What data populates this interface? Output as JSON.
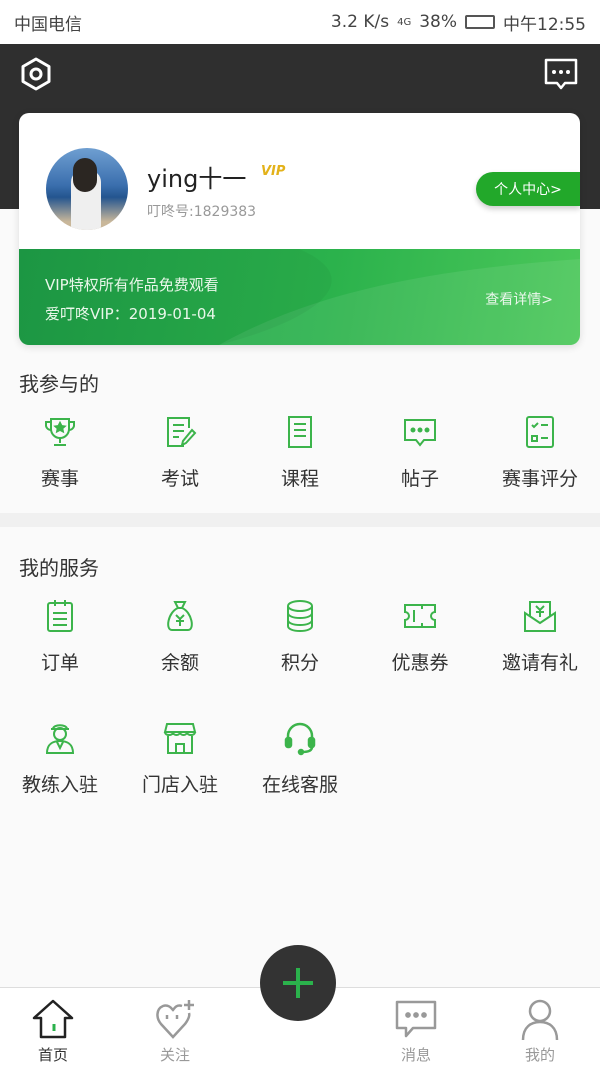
{
  "status_bar": {
    "carrier": "中国电信",
    "speed": "3.2 K/s",
    "network": "4G",
    "battery": "38%",
    "time": "中午12:55"
  },
  "header": {
    "settings_icon": "hexagon-gear-icon",
    "message_icon": "chat-bubble-icon"
  },
  "profile": {
    "name": "ying十一",
    "vip_badge": "VIP",
    "id_label": "叮咚号:1829383",
    "center_button": "个人中心>"
  },
  "vip": {
    "line1": "VIP特权所有作品免费观看",
    "line2": "爱叮咚VIP：2019-01-04",
    "details": "查看详情>"
  },
  "participated": {
    "title": "我参与的",
    "items": [
      {
        "label": "赛事",
        "icon": "trophy-icon"
      },
      {
        "label": "考试",
        "icon": "exam-icon"
      },
      {
        "label": "课程",
        "icon": "course-icon"
      },
      {
        "label": "帖子",
        "icon": "post-icon"
      },
      {
        "label": "赛事评分",
        "icon": "score-icon"
      }
    ]
  },
  "services": {
    "title": "我的服务",
    "items": [
      {
        "label": "订单",
        "icon": "order-icon"
      },
      {
        "label": "余额",
        "icon": "money-bag-icon"
      },
      {
        "label": "积分",
        "icon": "coins-icon"
      },
      {
        "label": "优惠券",
        "icon": "coupon-icon"
      },
      {
        "label": "邀请有礼",
        "icon": "invite-icon"
      },
      {
        "label": "教练入驻",
        "icon": "coach-icon"
      },
      {
        "label": "门店入驻",
        "icon": "store-icon"
      },
      {
        "label": "在线客服",
        "icon": "headset-icon"
      }
    ]
  },
  "tabbar": {
    "items": [
      {
        "label": "首页",
        "icon": "home-icon",
        "active": true
      },
      {
        "label": "关注",
        "icon": "heart-plus-icon"
      },
      {
        "label": "消息",
        "icon": "message-icon"
      },
      {
        "label": "我的",
        "icon": "user-icon"
      }
    ],
    "add_icon": "plus-icon"
  },
  "colors": {
    "accent": "#2bb24c",
    "header": "#2f2f2f",
    "vip_gold": "#e3b21a"
  }
}
